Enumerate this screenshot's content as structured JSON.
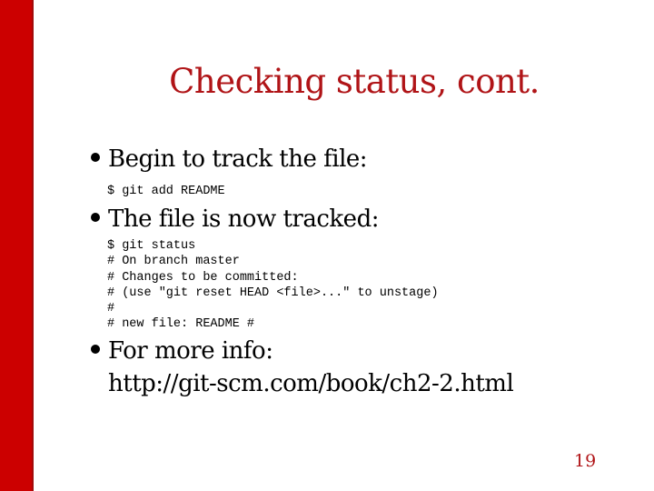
{
  "slide": {
    "title": "Checking status, cont.",
    "page_number": "19",
    "accent_color": "#cc0000",
    "title_color": "#b01417"
  },
  "bullets": [
    {
      "text": "Begin to track the file:",
      "code": [
        "$ git add README"
      ]
    },
    {
      "text": "The file is now tracked:",
      "code": [
        "$ git status",
        "# On branch master",
        "# Changes to be committed:",
        "# (use \"git reset HEAD <file>...\" to unstage)",
        "#",
        "# new file: README #"
      ]
    },
    {
      "text": "For more info:",
      "link": "http://git-scm.com/book/ch2-2.html"
    }
  ]
}
